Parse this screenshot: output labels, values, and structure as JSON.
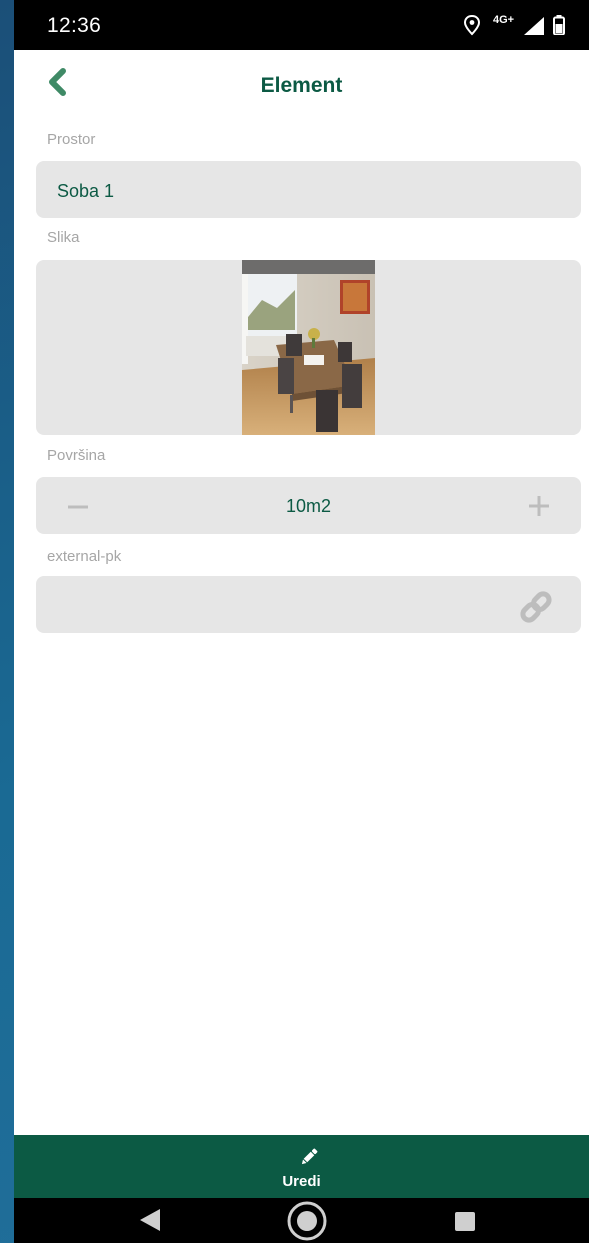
{
  "status_bar": {
    "time": "12:36",
    "network": "4G+"
  },
  "header": {
    "title": "Element",
    "back_icon": "chevron-left-icon"
  },
  "form": {
    "prostor": {
      "label": "Prostor",
      "value": "Soba 1"
    },
    "slika": {
      "label": "Slika"
    },
    "povrsina": {
      "label": "Površina",
      "value": "10m2",
      "minus_icon": "minus-icon",
      "plus_icon": "plus-icon"
    },
    "external_pk": {
      "label": "external-pk",
      "value": "",
      "link_icon": "link-icon"
    }
  },
  "bottom_action": {
    "label": "Uredi",
    "icon": "pencil-icon"
  },
  "colors": {
    "accent": "#0c5a44",
    "field_bg": "#e6e6e6",
    "label": "#a6a6a6"
  }
}
